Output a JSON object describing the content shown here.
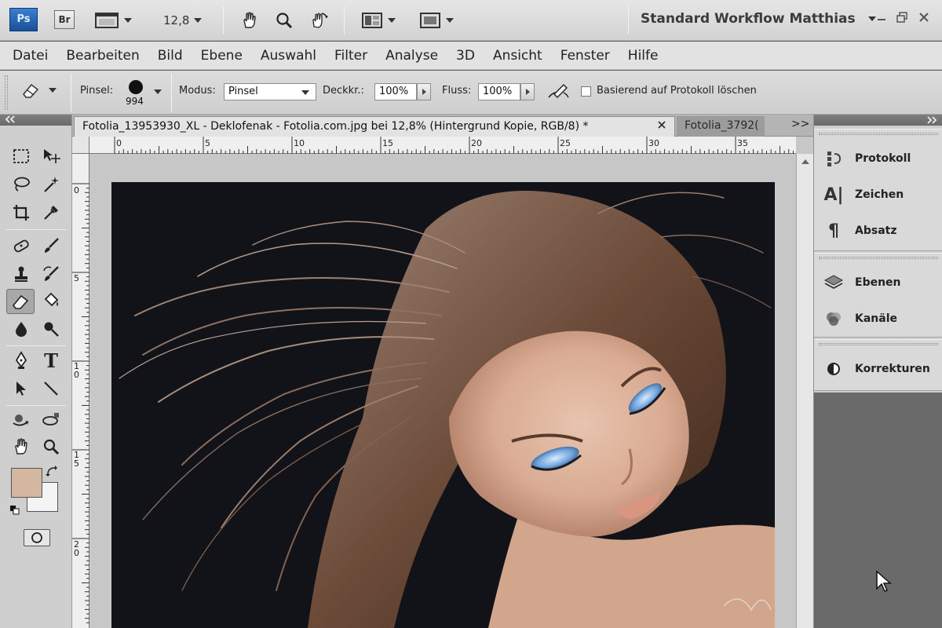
{
  "appbar": {
    "ps_logo": "Ps",
    "br_logo": "Br",
    "zoom": "12,8",
    "workspace": "Standard Workflow Matthias",
    "icons": [
      "screen-mode-icon",
      "hand-tool-icon",
      "zoom-tool-icon",
      "rotate-view-icon",
      "arrange-documents-icon",
      "screen-mode-select-icon"
    ]
  },
  "menu": [
    "Datei",
    "Bearbeiten",
    "Bild",
    "Ebene",
    "Auswahl",
    "Filter",
    "Analyse",
    "3D",
    "Ansicht",
    "Fenster",
    "Hilfe"
  ],
  "options": {
    "brush_label": "Pinsel:",
    "brush_size": "994",
    "mode_label": "Modus:",
    "mode_value": "Pinsel",
    "opacity_label": "Deckkr.:",
    "opacity_value": "100%",
    "flow_label": "Fluss:",
    "flow_value": "100%",
    "history_label": "Basierend auf Protokoll löschen"
  },
  "document": {
    "active_tab": "Fotolia_13953930_XL - Deklofenak - Fotolia.com.jpg bei 12,8% (Hintergrund Kopie, RGB/8) *",
    "inactive_tab": "Fotolia_3792(",
    "more": ">>"
  },
  "ruler_h": [
    "0",
    "5",
    "10",
    "15",
    "20",
    "25",
    "30",
    "35"
  ],
  "ruler_v": [
    "0",
    "5",
    "1 0",
    "1 5",
    "2 0"
  ],
  "panels": {
    "group1": [
      "Protokoll",
      "Zeichen",
      "Absatz"
    ],
    "group2": [
      "Ebenen",
      "Kanäle"
    ],
    "group3": [
      "Korrekturen"
    ]
  },
  "colors": {
    "foreground": "#d3b7a1",
    "background": "#f4f4f4"
  }
}
